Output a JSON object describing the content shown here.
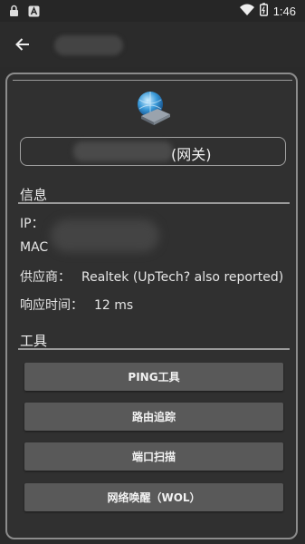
{
  "status_bar": {
    "time": "1:46",
    "icons": [
      "lock-icon",
      "a-notification-icon",
      "wifi-icon",
      "battery-icon"
    ]
  },
  "app_bar": {
    "back_icon": "arrow-left-icon"
  },
  "device": {
    "icon": "router-globe-icon",
    "gateway_suffix": "(网关)"
  },
  "info": {
    "section_title": "信息",
    "ip_label": "IP：",
    "mac_label": "MAC",
    "vendor_label": "供应商：",
    "vendor_value": "Realtek (UpTech? also reported)",
    "response_label": "响应时间：",
    "response_value": "12 ms"
  },
  "tools": {
    "section_title": "工具",
    "buttons": [
      "PING工具",
      "路由追踪",
      "端口扫描",
      "网络唤醒（WOL）"
    ]
  }
}
